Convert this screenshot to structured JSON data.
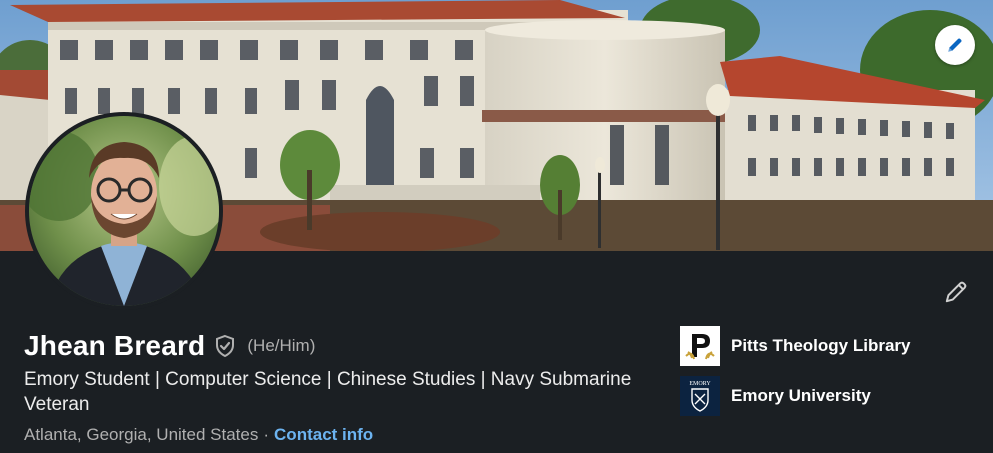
{
  "profile": {
    "name": "Jhean Breard",
    "pronouns": "(He/Him)",
    "headline": "Emory Student | Computer Science | Chinese Studies | Navy Submarine Veteran",
    "location": "Atlanta, Georgia, United States",
    "separator": "·",
    "contact_label": "Contact info"
  },
  "organizations": [
    {
      "name": "Pitts Theology Library",
      "logo_icon": "pitts-library-logo"
    },
    {
      "name": "Emory University",
      "logo_icon": "emory-shield-logo",
      "logo_text": "EMORY"
    }
  ],
  "icons": {
    "edit_cover": "pencil-icon",
    "edit_profile": "pencil-icon",
    "verification": "shield-check-icon"
  },
  "colors": {
    "background": "#1b1f23",
    "link": "#6cb3f0",
    "secondary_text": "#b0b0b0",
    "roof": "#b5462e",
    "emory_blue": "#0c2340"
  }
}
